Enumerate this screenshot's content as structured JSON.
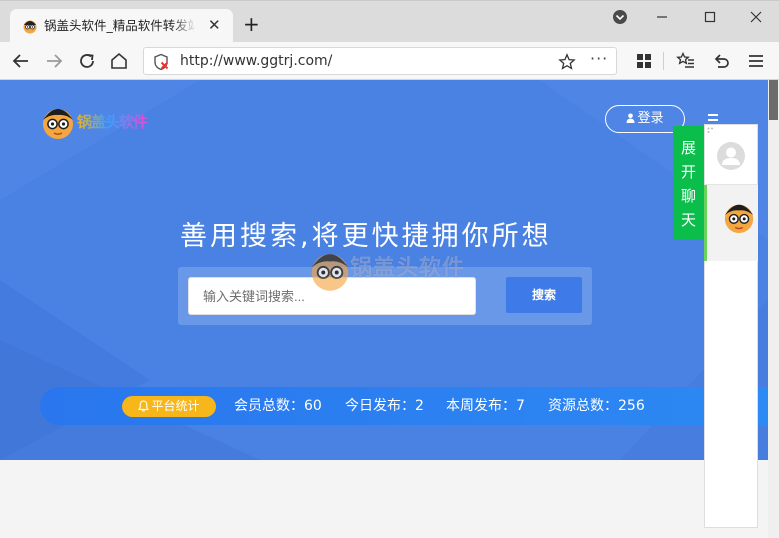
{
  "browser": {
    "tab": {
      "title": "锅盖头软件_精品软件转发站"
    },
    "url": "http://www.ggtrj.com/",
    "more_glyph": "···",
    "window_controls": [
      "minimize",
      "maximize",
      "close"
    ]
  },
  "site": {
    "logo_text": "锅盖头软件",
    "login_label": "登录",
    "headline": "善用搜索,将更快捷拥你所想",
    "search": {
      "placeholder": "输入关键词搜索...",
      "button_label": "搜索"
    },
    "watermark": {
      "name": "锅盖头软件",
      "url": "www.ggtrj.com"
    },
    "stats": {
      "badge": "平台统计",
      "items": [
        {
          "label": "会员总数：",
          "value": "60"
        },
        {
          "label": "今日发布：",
          "value": "2"
        },
        {
          "label": "本周发布：",
          "value": "7"
        },
        {
          "label": "资源总数：",
          "value": "256"
        }
      ]
    }
  },
  "chat": {
    "toggle_chars": [
      "展",
      "开",
      "聊",
      "天"
    ]
  },
  "colors": {
    "hero": "#4a82e4",
    "accent": "#3f7be8",
    "badge": "#f7b619",
    "chat_green": "#0bbd4b"
  }
}
